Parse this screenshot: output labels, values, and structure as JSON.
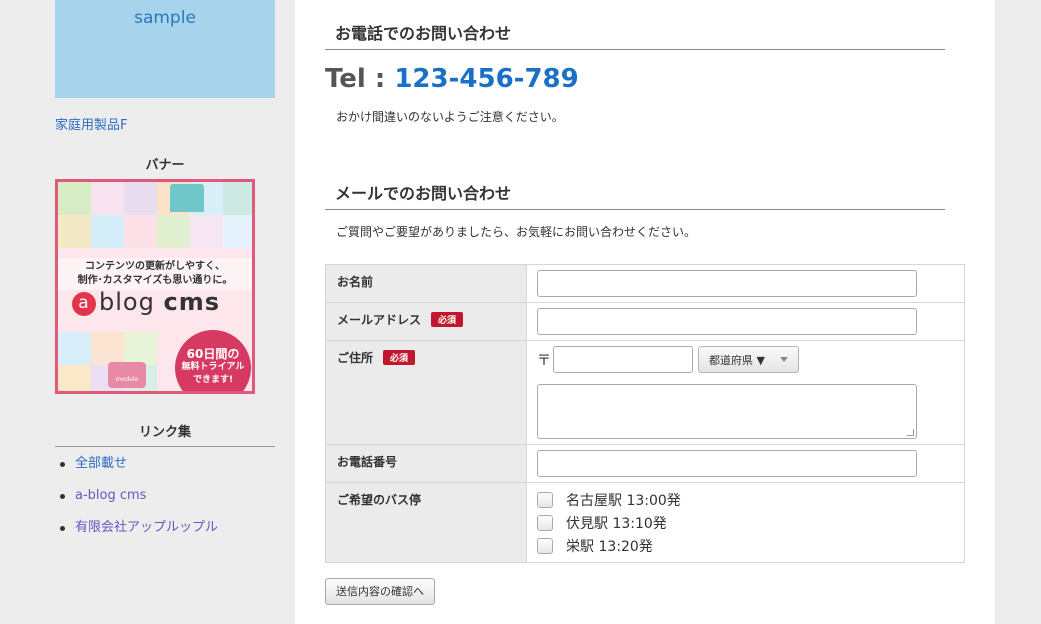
{
  "sidebar": {
    "sample_label": "sample",
    "product_link": "家庭用製品F",
    "banner_heading": "バナー",
    "banner": {
      "copy_line1": "コンテンツの更新がしやすく、",
      "copy_line2": "制作･カスタマイズも思い通りに。",
      "logo_mark": "a",
      "logo_light": "blog",
      "logo_bold": "cms",
      "badge_line1": "60日間の",
      "badge_line2": "無料トライアル",
      "badge_line3": "できます!",
      "module_label": "module"
    },
    "links_heading": "リンク集",
    "links": [
      {
        "label": "全部載せ"
      },
      {
        "label": "a-blog cms"
      },
      {
        "label": "有限会社アップルップル"
      }
    ]
  },
  "main": {
    "phone_section": {
      "title": "お電話でのお問い合わせ",
      "tel_prefix": "Tel : ",
      "tel_number": "123-456-789",
      "note": "おかけ間違いのないようご注意ください。"
    },
    "mail_section": {
      "title": "メールでのお問い合わせ",
      "note": "ご質問やご要望がありましたら、お気軽にお問い合わせください。"
    },
    "form": {
      "required_badge": "必須",
      "name_label": "お名前",
      "email_label": "メールアドレス",
      "address_label": "ご住所",
      "zip_mark": "〒",
      "prefecture_select": "都道府県 ▼",
      "phone_label": "お電話番号",
      "bus_label": "ご希望のバス停",
      "bus_options": [
        {
          "label": "名古屋駅 13:00発"
        },
        {
          "label": "伏見駅 13:10発"
        },
        {
          "label": "栄駅 13:20発"
        }
      ],
      "submit_label": "送信内容の確認へ"
    }
  },
  "colors": {
    "accent": "#1a6fc6",
    "required": "#c0172f",
    "banner_border": "#e0587a"
  }
}
